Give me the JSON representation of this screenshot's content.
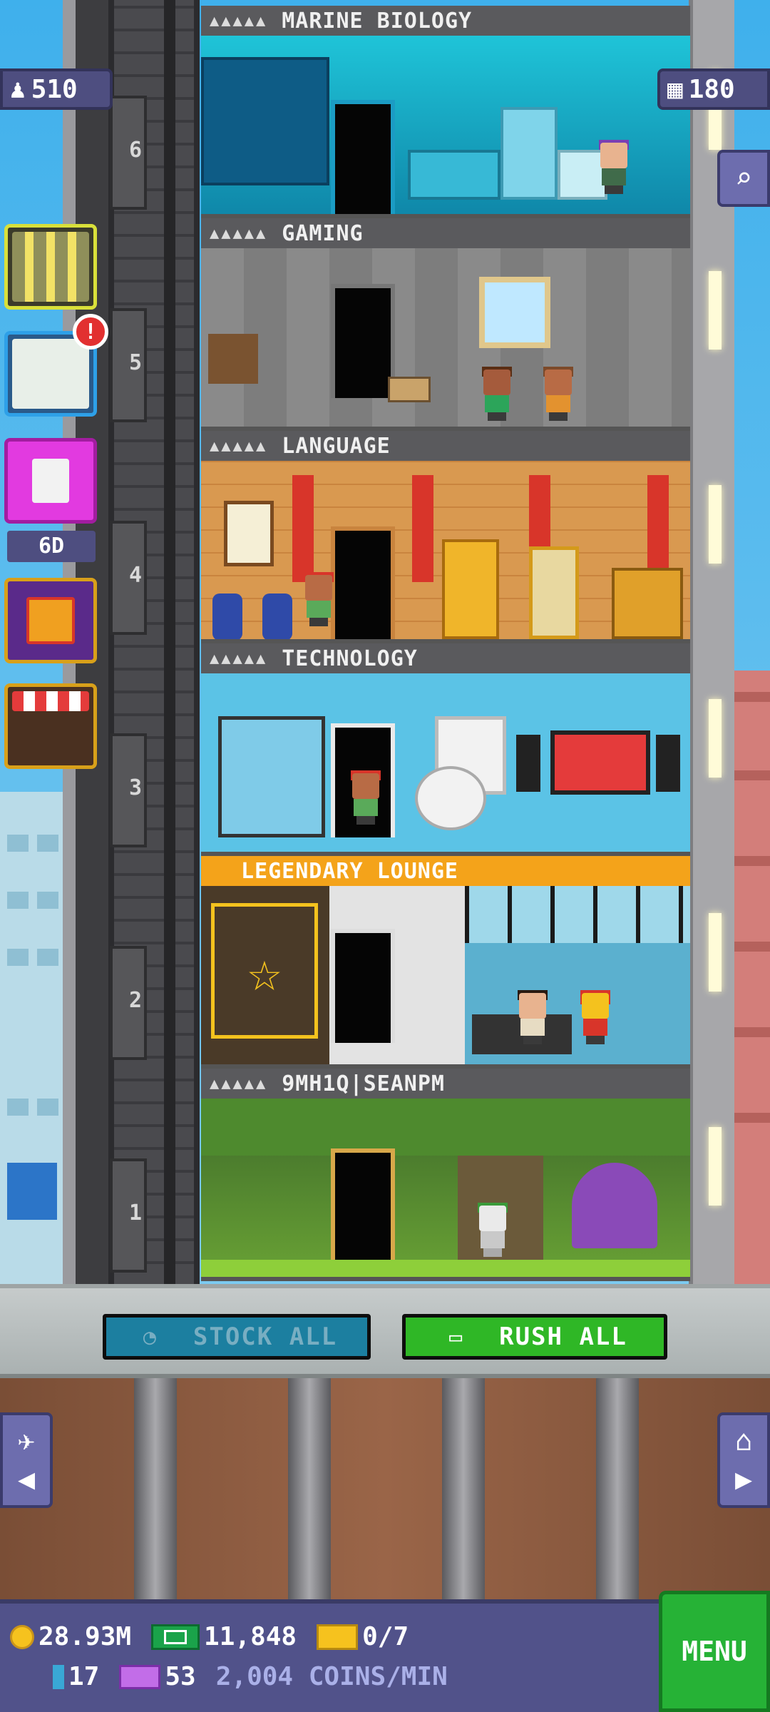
{
  "top_stats": {
    "population": "510",
    "floors": "180"
  },
  "side_menu": {
    "dice_label": "6D",
    "alert_badge": "!"
  },
  "floors": [
    {
      "name": "MARINE BIOLOGY",
      "number": "6",
      "type": "marine"
    },
    {
      "name": "GAMING",
      "number": "5",
      "type": "gaming"
    },
    {
      "name": "LANGUAGE",
      "number": "4",
      "type": "language"
    },
    {
      "name": "TECHNOLOGY",
      "number": "3",
      "type": "tech"
    },
    {
      "name": "LEGENDARY LOUNGE",
      "number": "2",
      "type": "lounge"
    },
    {
      "name": "9MH1Q|SEANPM",
      "number": "1",
      "type": "forest"
    }
  ],
  "floor_people_icons": "▲▲▲▲▲",
  "actions": {
    "stock_all": "STOCK ALL",
    "rush_all": "RUSH ALL"
  },
  "hud": {
    "coins": "28.93M",
    "bux": "11,848",
    "tickets": "0/7",
    "cubes": "17",
    "vip": "53",
    "rate": "2,004 COINS/MIN"
  },
  "menu_label": "MENU",
  "colors": {
    "legendary_header": "#f4a31a",
    "rush_green": "#2fb726",
    "stock_blue": "#1c7fa0",
    "hud_purple": "#51528a"
  }
}
